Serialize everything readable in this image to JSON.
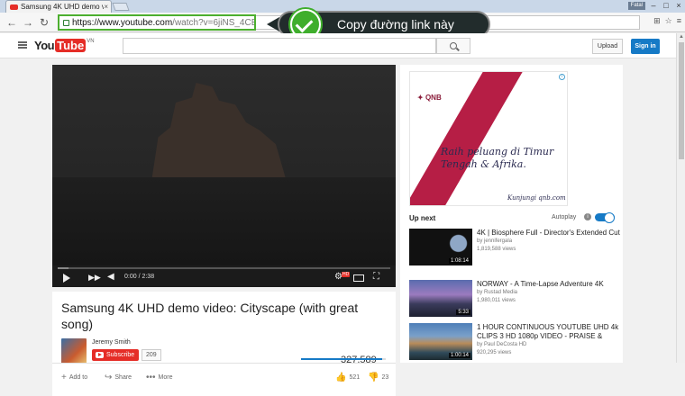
{
  "browser": {
    "tab_title": "Samsung 4K UHD demo v",
    "tab_close": "×",
    "window_user": "Fatal",
    "url_host": "https://www.youtube.com",
    "url_path": "/watch?v=6jiNS_4CEug",
    "callout_text": "Copy đường link này"
  },
  "header": {
    "logo_you": "You",
    "logo_tube": "Tube",
    "logo_country": "VN",
    "upload_label": "Upload",
    "signin_label": "Sign in"
  },
  "player": {
    "time": "0:00 / 2:38",
    "hd_badge": "HD"
  },
  "video": {
    "title": "Samsung 4K UHD demo video: Cityscape (with great song)",
    "channel": "Jeremy Smith",
    "subscribe_label": "Subscribe",
    "subscriber_count": "209",
    "views": "327,589",
    "like_ratio": 0.96,
    "add_to_label": "Add to",
    "share_label": "Share",
    "more_label": "More",
    "likes": "521",
    "dislikes": "23"
  },
  "sidebar": {
    "ad": {
      "brand": "QNB",
      "headline": "Raih peluang di Timur Tengah & Afrika.",
      "cta": "Kunjungi qnb.com"
    },
    "up_next_label": "Up next",
    "autoplay_label": "Autoplay",
    "autoplay_on": true,
    "recommendations": [
      {
        "title": "4K | Biosphere Full - Director's Extended Cut",
        "channel": "by jennifergala",
        "views": "1,819,588 views",
        "duration": "1:08:14"
      },
      {
        "title": "NORWAY - A Time-Lapse Adventure 4K",
        "channel": "by Rustad Media",
        "views": "1,980,011 views",
        "duration": "5:33"
      },
      {
        "title": "1 HOUR CONTINUOUS YOUTUBE UHD 4k CLIPS 3 HD 1080p VIDEO - PRAISE &",
        "channel": "by Paul DeCosta HD",
        "views": "920,295 views",
        "duration": "1:00:14"
      }
    ]
  },
  "icons": {
    "back": "back-arrow-icon",
    "forward": "forward-arrow-icon",
    "reload": "reload-icon",
    "menu": "hamburger-menu-icon",
    "search": "search-icon",
    "play": "play-icon",
    "next": "next-icon",
    "volume": "volume-icon",
    "settings": "gear-icon",
    "fullscreen": "fullscreen-icon"
  },
  "colors": {
    "youtube_red": "#e52d27",
    "signin_blue": "#167ac6",
    "highlight_green": "#4caf2f"
  }
}
